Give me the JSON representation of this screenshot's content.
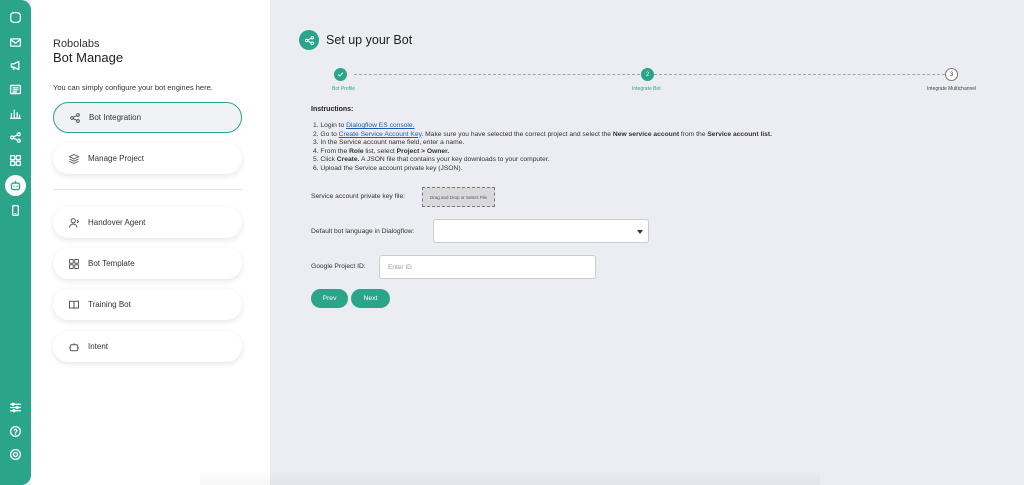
{
  "rail": {
    "icons": [
      "chat-icon",
      "mail-icon",
      "megaphone-icon",
      "newspaper-icon",
      "bar-chart-icon",
      "share-icon",
      "grid-icon",
      "bot-icon",
      "mobile-icon",
      "sliders-icon",
      "help-icon",
      "settings-icon"
    ],
    "active": "bot-icon"
  },
  "panel": {
    "brand": "Robolabs",
    "title": "Bot Manage",
    "subtitle": "You can simply configure your bot engines here.",
    "items": [
      {
        "label": "Bot Integration",
        "icon": "share-icon",
        "active": true
      },
      {
        "label": "Manage Project",
        "icon": "layers-icon",
        "active": false
      },
      {
        "label": "Handover Agent",
        "icon": "user-icon",
        "active": false
      },
      {
        "label": "Bot Template",
        "icon": "grid-icon",
        "active": false
      },
      {
        "label": "Training Bot",
        "icon": "book-icon",
        "active": false
      },
      {
        "label": "Intent",
        "icon": "bot-icon",
        "active": false
      }
    ]
  },
  "main": {
    "title": "Set up your Bot",
    "steps": [
      {
        "number": "",
        "label": "Bot Profile",
        "state": "done"
      },
      {
        "number": "2",
        "label": "Integrate Bot",
        "state": "current"
      },
      {
        "number": "3",
        "label": "Integrate Multichannel",
        "state": "todo"
      }
    ],
    "instructions_title": "Instructions:",
    "instructions": {
      "l1_pre": "1. Login to ",
      "l1_link": "Dialogflow ES console.",
      "l2_pre": "2. Go to ",
      "l2_link": "Create Service Account Key",
      "l2_mid": ". Make sure you have selected the correct project and select the ",
      "l2_b1": "New service account",
      "l2_mid2": " from the ",
      "l2_b2": "Service account list.",
      "l3": "3. In the Service account name field, enter a name.",
      "l4_pre": "4. From the ",
      "l4_b1": "Role",
      "l4_mid": " list, select ",
      "l4_b2": "Project > Owner.",
      "l5_pre": "5. Click ",
      "l5_b1": "Create.",
      "l5_post": " A JSON file that contains your key downloads to your computer.",
      "l6": "6. Upload the Service account private key (JSON)."
    },
    "fields": {
      "private_key_label": "Service account private key file:",
      "file_drop": "Drag and Drop or Select File",
      "language_label": "Default bot language in Dialogflow:",
      "language_value": "",
      "project_id_label": "Google Project ID:",
      "project_id_placeholder": "Enter ID",
      "project_id_value": ""
    },
    "buttons": {
      "prev": "Prev",
      "next": "Next"
    }
  },
  "colors": {
    "accent": "#2aa58a",
    "link": "#1a5fb4",
    "background": "#ececf3"
  }
}
